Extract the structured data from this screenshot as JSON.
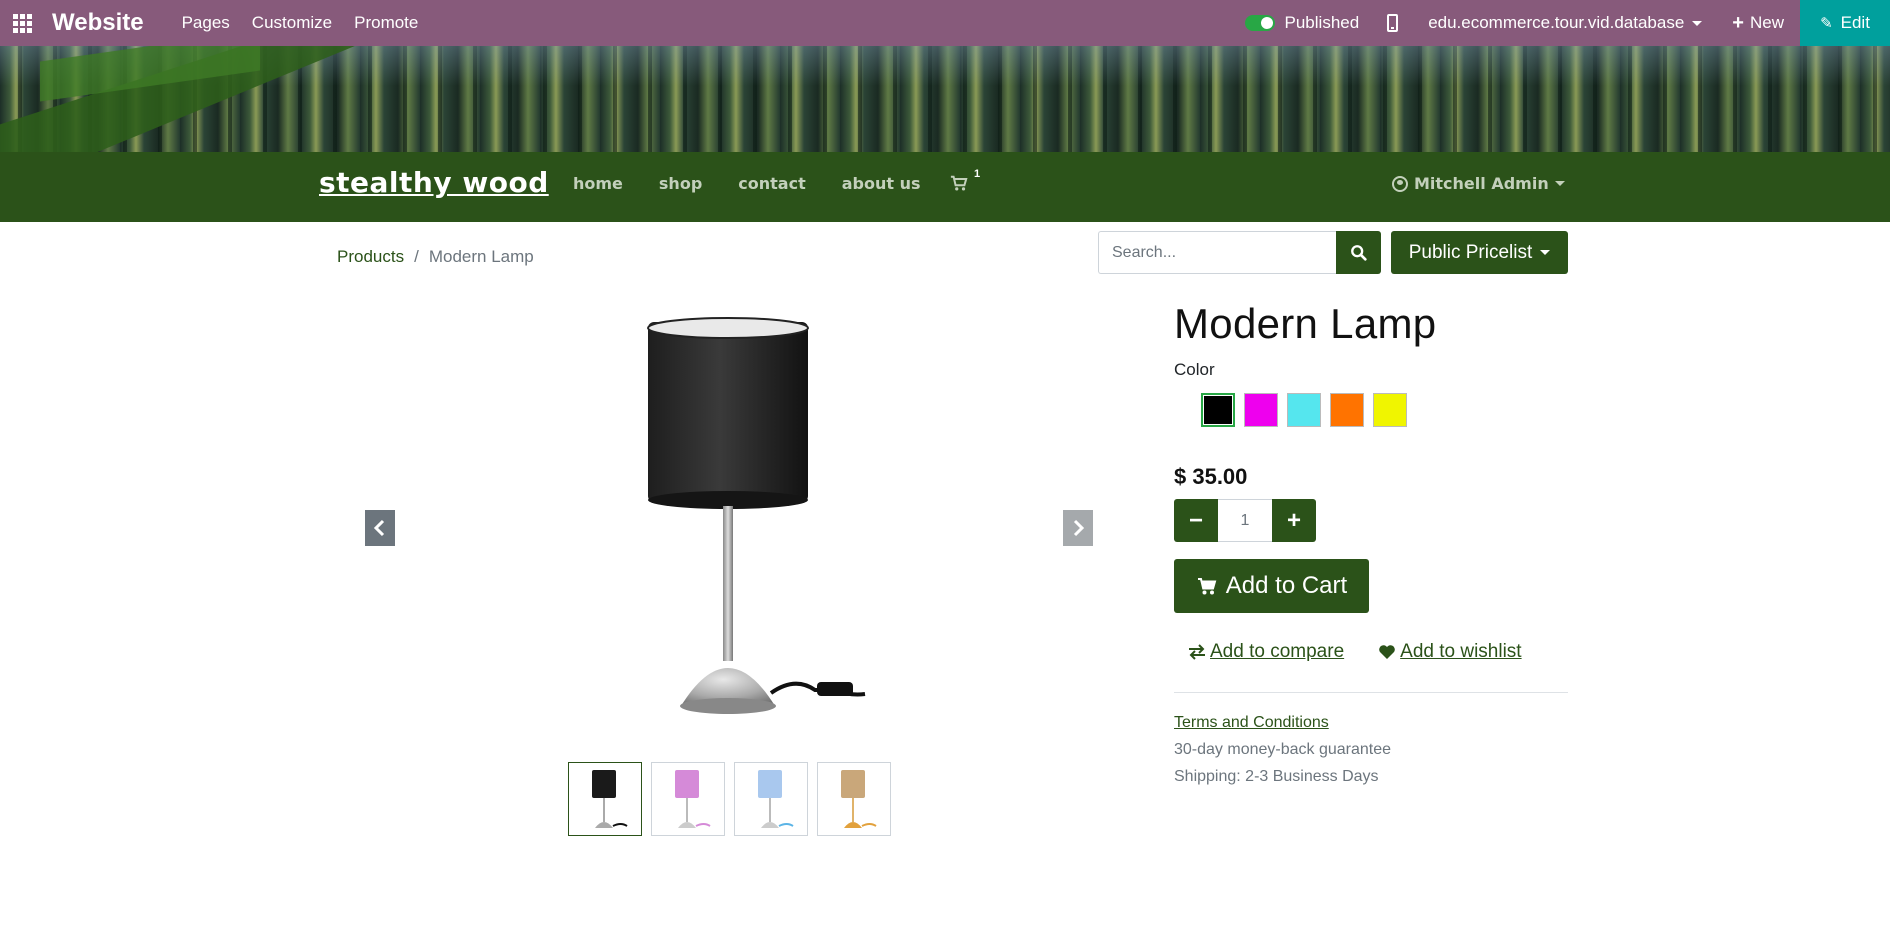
{
  "topbar": {
    "brand": "Website",
    "menu": [
      "Pages",
      "Customize",
      "Promote"
    ],
    "publish_label": "Published",
    "publish_on": true,
    "database": "edu.ecommerce.tour.vid.database",
    "new_label": "New",
    "edit_label": "Edit",
    "colors": {
      "bar": "#875a7b",
      "edit": "#00a09d"
    }
  },
  "site": {
    "logo": "stealthy wood",
    "nav": [
      "home",
      "shop",
      "contact",
      "about us"
    ],
    "cart_count": "1",
    "user": "Mitchell Admin",
    "color": "#2b5219"
  },
  "breadcrumb": {
    "parent": "Products",
    "separator": "/",
    "current": "Modern Lamp"
  },
  "search": {
    "placeholder": "Search..."
  },
  "pricelist": {
    "label": "Public Pricelist"
  },
  "product": {
    "title": "Modern Lamp",
    "attribute_label": "Color",
    "swatches": [
      {
        "color": "#000000",
        "selected": true
      },
      {
        "color": "#ee00ee",
        "selected": false
      },
      {
        "color": "#55e6ee",
        "selected": false
      },
      {
        "color": "#ff7300",
        "selected": false
      },
      {
        "color": "#f0f500",
        "selected": false
      }
    ],
    "price": "$ 35.00",
    "quantity": "1",
    "add_to_cart": "Add to Cart",
    "compare": " Add to compare",
    "wishlist": " Add to wishlist",
    "terms": "Terms and Conditions",
    "info1": "30-day money-back guarantee",
    "info2": "Shipping: 2-3 Business Days",
    "thumbnails": [
      {
        "shade": "#1a1a1a",
        "cord": "#111111"
      },
      {
        "shade": "#d58ad8",
        "cord": "#d58ad8"
      },
      {
        "shade": "#a9c8ee",
        "cord": "#5bb4e6"
      },
      {
        "shade": "#c9a77a",
        "cord": "#e2a13c"
      }
    ]
  }
}
